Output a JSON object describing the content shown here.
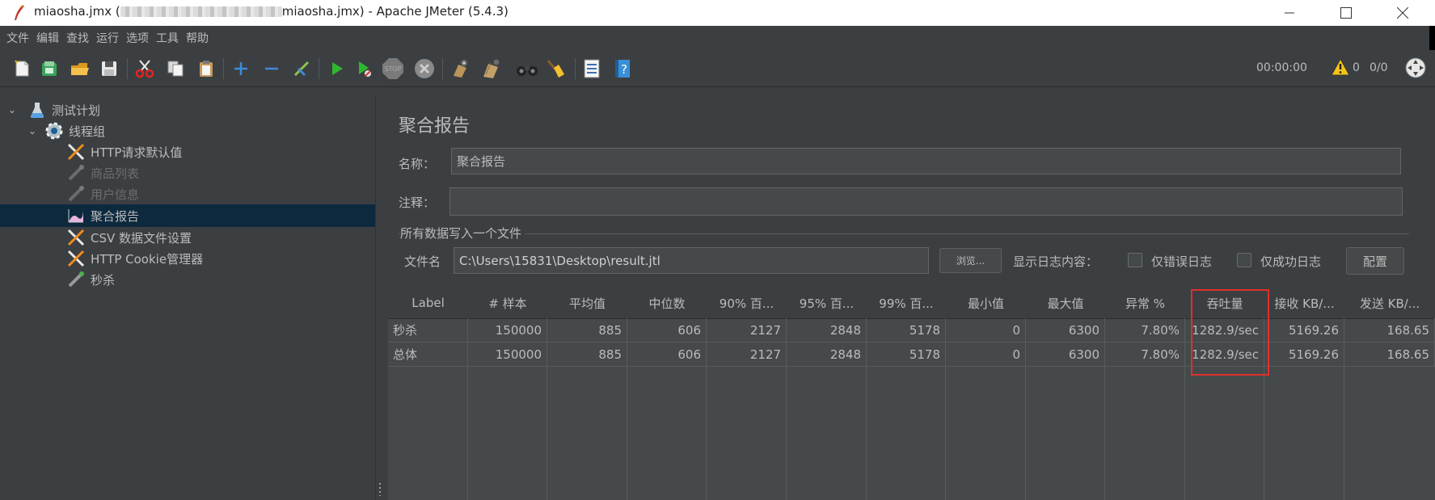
{
  "window": {
    "title_file": "miaosha.jmx",
    "title_path_open": " (",
    "title_path_end": "miaosha.jmx)",
    "title_app": " - Apache JMeter (5.4.3)",
    "controls": [
      "minimize",
      "maximize",
      "close"
    ]
  },
  "menu": [
    "文件",
    "编辑",
    "查找",
    "运行",
    "选项",
    "工具",
    "帮助"
  ],
  "toolbar": {
    "buttons": [
      "new-icon",
      "templates-icon",
      "open-icon",
      "save-icon",
      "cut-icon",
      "copy-icon",
      "paste-icon",
      "expand-icon",
      "collapse-icon",
      "toggle-icon",
      "start-icon",
      "start-no-pause-icon",
      "stop-icon",
      "shutdown-icon",
      "clear-icon",
      "clear-all-icon",
      "search-icon",
      "reset-search-icon",
      "function-helper-icon",
      "help-icon"
    ],
    "elapsed_time": "00:00:00",
    "warning_count": "0",
    "threads": "0/0"
  },
  "tree": [
    {
      "label": "测试计划",
      "icon": "flask-icon",
      "level": 0,
      "expanded": true,
      "disabled": false,
      "selected": false
    },
    {
      "label": "线程组",
      "icon": "gear-icon",
      "level": 1,
      "expanded": true,
      "disabled": false,
      "selected": false
    },
    {
      "label": "HTTP请求默认值",
      "icon": "wrench-screwdriver-icon",
      "level": 2,
      "disabled": false,
      "selected": false
    },
    {
      "label": "商品列表",
      "icon": "pipette-icon",
      "level": 2,
      "disabled": true,
      "selected": false
    },
    {
      "label": "用户信息",
      "icon": "pipette-icon",
      "level": 2,
      "disabled": true,
      "selected": false
    },
    {
      "label": "聚合报告",
      "icon": "chart-icon",
      "level": 2,
      "disabled": false,
      "selected": true
    },
    {
      "label": "CSV 数据文件设置",
      "icon": "wrench-screwdriver-icon",
      "level": 2,
      "disabled": false,
      "selected": false
    },
    {
      "label": "HTTP Cookie管理器",
      "icon": "wrench-screwdriver-icon",
      "level": 2,
      "disabled": false,
      "selected": false
    },
    {
      "label": "秒杀",
      "icon": "pipette-icon",
      "level": 2,
      "disabled": false,
      "selected": false
    }
  ],
  "panel": {
    "title": "聚合报告",
    "name_label": "名称：",
    "name_value": "聚合报告",
    "comment_label": "注释：",
    "comment_value": "",
    "file_group_title": "所有数据写入一个文件",
    "filename_label": "文件名",
    "filename_value": "C:\\Users\\15831\\Desktop\\result.jtl",
    "browse_label": "浏览...",
    "log_display_label": "显示日志内容：",
    "errors_only_label": "仅错误日志",
    "errors_only_checked": false,
    "success_only_label": "仅成功日志",
    "success_only_checked": false,
    "configure_label": "配置"
  },
  "table": {
    "headers": [
      "Label",
      "# 样本",
      "平均值",
      "中位数",
      "90% 百...",
      "95% 百...",
      "99% 百...",
      "最小值",
      "最大值",
      "异常 %",
      "吞吐量",
      "接收 KB/...",
      "发送 KB/..."
    ],
    "rows": [
      [
        "秒杀",
        "150000",
        "885",
        "606",
        "2127",
        "2848",
        "5178",
        "0",
        "6300",
        "7.80%",
        "1282.9/sec",
        "5169.26",
        "168.65"
      ],
      [
        "总体",
        "150000",
        "885",
        "606",
        "2127",
        "2848",
        "5178",
        "0",
        "6300",
        "7.80%",
        "1282.9/sec",
        "5169.26",
        "168.65"
      ]
    ],
    "highlighted_column": "吞吐量",
    "highlight_color": "#e0302c"
  },
  "colors": {
    "background": "#3c3f41",
    "selection": "#0d293e",
    "text": "#bbbbbb",
    "table_body": "#45494a"
  }
}
